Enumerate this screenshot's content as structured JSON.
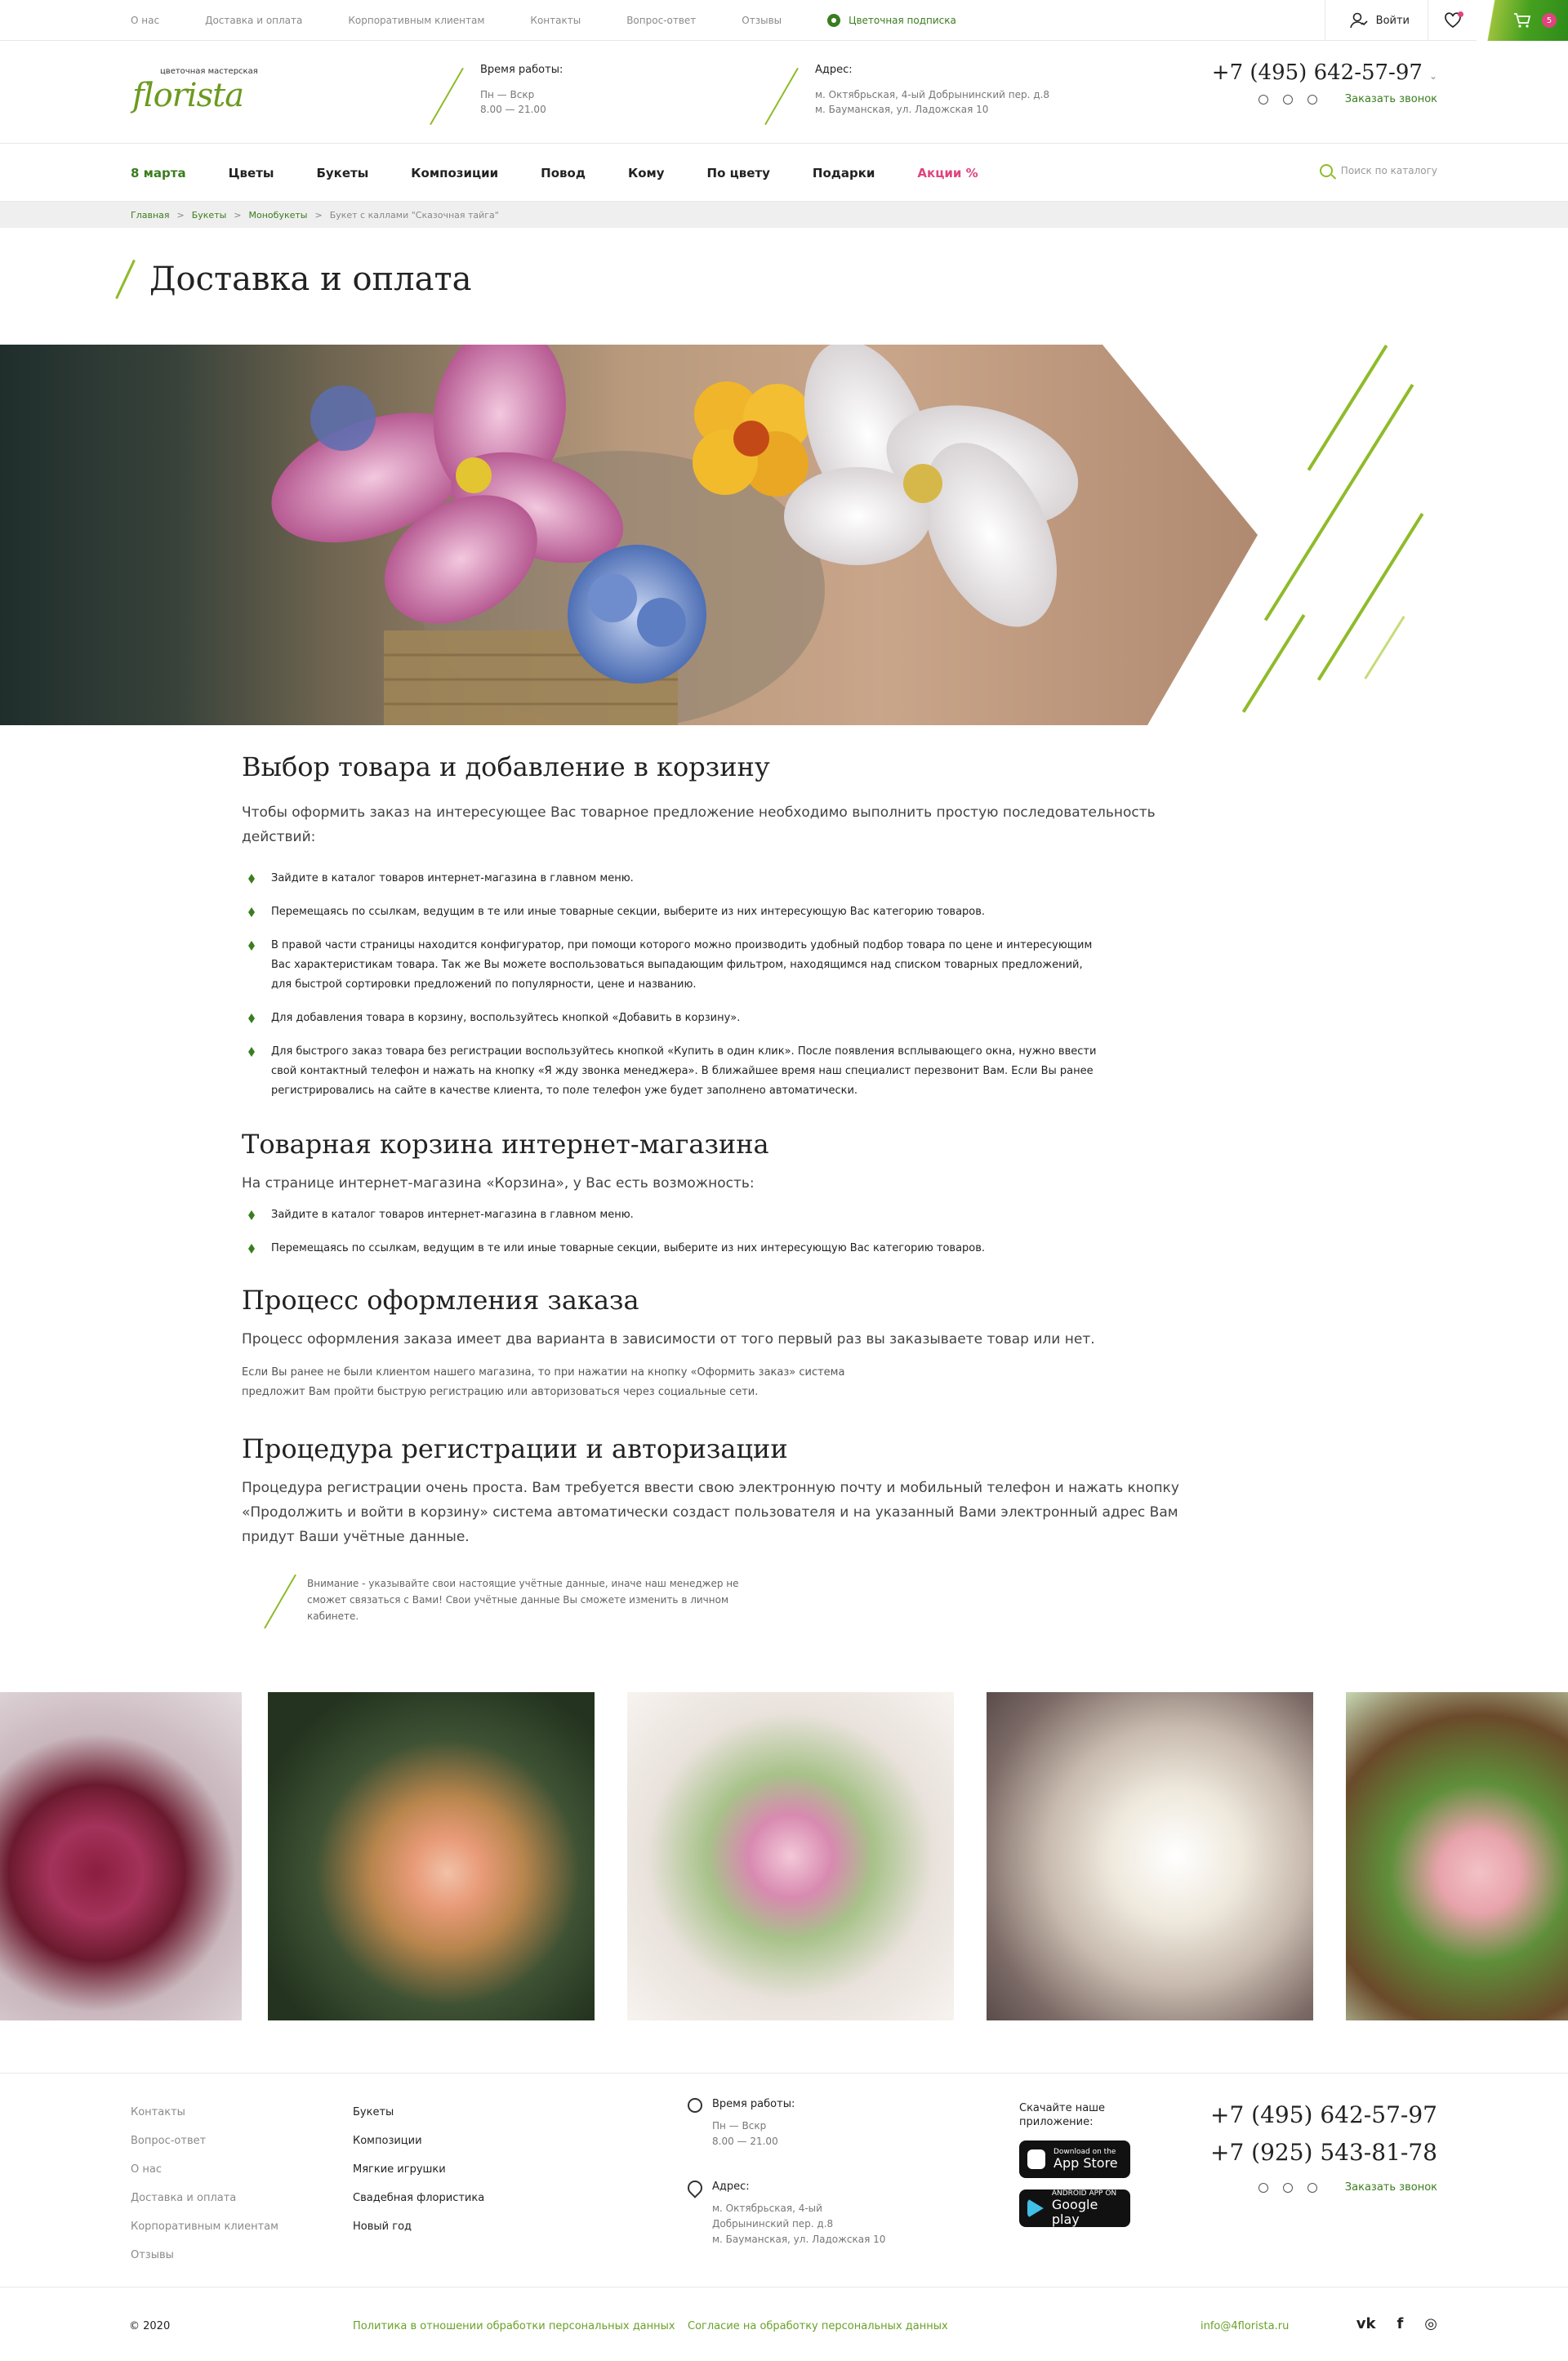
{
  "topbar": {
    "links": [
      "О нас",
      "Доставка и оплата",
      "Корпоративным клиентам",
      "Контакты",
      "Вопрос-ответ",
      "Отзывы"
    ],
    "subscription": "Цветочная подписка",
    "login": "Войти",
    "cart_count": "5"
  },
  "header": {
    "logo_small": "цветочная мастерская",
    "logo_name": "florista",
    "work_title": "Время работы:",
    "work_days": "Пн — Вскр",
    "work_hours": "8.00 — 21.00",
    "address_title": "Адрес:",
    "address_1": "м. Октябрьская, 4-ый Добрынинский пер. д.8",
    "address_2": "м. Бауманская, ул. Ладожская 10",
    "phone": "+7 (495) 642-57-97",
    "phone_chevron": "⌄",
    "callback": "Заказать звонок"
  },
  "nav": {
    "items": [
      "8 марта",
      "Цветы",
      "Букеты",
      "Композиции",
      "Повод",
      "Кому",
      "По цвету",
      "Подарки",
      "Акции %"
    ],
    "search_placeholder": "Поиск по каталогу"
  },
  "breadcrumb": [
    "Главная",
    "Букеты",
    "Монобукеты",
    "Букет с каллами \"Сказочная тайга\""
  ],
  "page_title": "Доставка и оплата",
  "sections": {
    "s1_title": "Выбор товара и добавление в корзину",
    "s1_lead": "Чтобы оформить заказ на интересующее Вас товарное предложение необходимо выполнить простую последовательность действий:",
    "s1_items": [
      "Зайдите в каталог товаров интернет-магазина в главном меню.",
      "Перемещаясь по ссылкам, ведущим в те или иные товарные секции, выберите из них интересующую Вас категорию товаров.",
      "В правой части страницы находится конфигуратор, при помощи которого можно производить удобный подбор товара по цене и интересующим Вас характеристикам товара. Так же Вы можете воспользоваться выпадающим фильтром, находящимся над списком товарных предложений, для быстрой сортировки предложений по популярности, цене и названию.",
      "Для добавления товара в корзину, воспользуйтесь кнопкой «Добавить в корзину».",
      "Для быстрого заказ товара без регистрации воспользуйтесь кнопкой «Купить в один клик». После появления всплывающего окна, нужно ввести свой контактный телефон и нажать на кнопку «Я жду звонка менеджера». В ближайшее время наш специалист перезвонит Вам. Если Вы ранее регистрировались на сайте в качестве клиента, то поле телефон уже будет заполнено автоматически."
    ],
    "s2_title": "Товарная корзина интернет-магазина",
    "s2_lead": "На странице интернет-магазина «Корзина», у Вас есть возможность:",
    "s2_items": [
      "Зайдите в каталог товаров интернет-магазина в главном меню.",
      "Перемещаясь по ссылкам, ведущим в те или иные товарные секции, выберите из них интересующую Вас категорию товаров."
    ],
    "s3_title": "Процесс оформления заказа",
    "s3_lead": "Процесс оформления заказа имеет два варианта в зависимости от того первый раз вы заказываете товар или нет.",
    "s3_small": "Если Вы ранее не были клиентом нашего магазина, то при нажатии на кнопку «Оформить заказ» система предложит Вам пройти быструю регистрацию или авторизоваться через социальные сети.",
    "s4_title": "Процедура регистрации и авторизации",
    "s4_lead": "Процедура регистрации очень проста. Вам требуется ввести свою электронную почту и мобильный телефон и нажать кнопку «Продолжить и войти в корзину» система автоматически создаст пользователя и на указанный Вами электронный адрес Вам придут Ваши учётные данные.",
    "note": "Внимание - указывайте свои настоящие учётные данные, иначе наш менеджер не сможет связаться с Вами! Свои учётные данные Вы сможете изменить в личном кабинете."
  },
  "footer": {
    "col1": [
      "Контакты",
      "Вопрос-ответ",
      "О нас",
      "Доставка и оплата",
      "Корпоративным клиентам",
      "Отзывы"
    ],
    "col2": [
      "Букеты",
      "Композиции",
      "Мягкие игрушки",
      "Свадебная флористика",
      "Новый год"
    ],
    "work_title": "Время работы:",
    "work_days": "Пн — Вскр",
    "work_hours": "8.00 — 21.00",
    "address_title": "Адрес:",
    "address_1": "м. Октябрьская, 4-ый Добрынинский пер. д.8",
    "address_2": "м. Бауманская, ул. Ладожская 10",
    "apps_title": "Скачайте наше приложение:",
    "appstore_small": "Download on the",
    "appstore": "App Store",
    "gplay_small": "ANDROID APP ON",
    "gplay": "Google play",
    "phone1": "+7 (495) 642-57-97",
    "phone2": "+7 (925) 543-81-78",
    "callback": "Заказать звонок",
    "copyright": "© 2020",
    "policy": "Политика в отношении обработки персональных данных",
    "consent": "Согласие на обработку персональных данных",
    "email": "info@4florista.ru",
    "social": [
      "vk",
      "f",
      "◎"
    ]
  },
  "colors": {
    "accent": "#3a7d1e",
    "lime": "#8fbb2a",
    "pink": "#e0437e"
  }
}
